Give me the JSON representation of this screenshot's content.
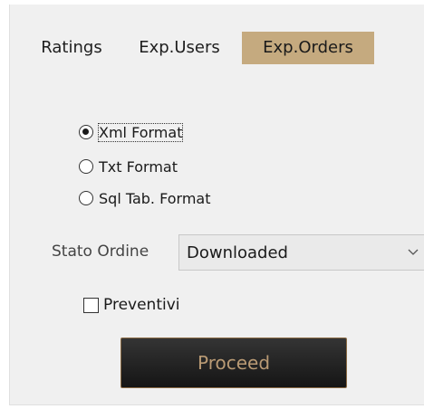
{
  "tabs": [
    {
      "label": "Ratings",
      "active": false
    },
    {
      "label": "Exp.Users",
      "active": false
    },
    {
      "label": "Exp.Orders",
      "active": true
    }
  ],
  "format_options": [
    {
      "label": "Xml Format",
      "checked": true
    },
    {
      "label": "Txt Format",
      "checked": false
    },
    {
      "label": "Sql Tab. Format",
      "checked": false
    }
  ],
  "stato_ordine": {
    "label": "Stato Ordine",
    "selected": "Downloaded"
  },
  "preventivi": {
    "label": "Preventivi",
    "checked": false
  },
  "proceed_label": "Proceed",
  "colors": {
    "active_tab": "#c5aa7f",
    "button_bg": "#1f1f1f",
    "button_text": "#b99a74",
    "button_border": "#8a6a43"
  }
}
